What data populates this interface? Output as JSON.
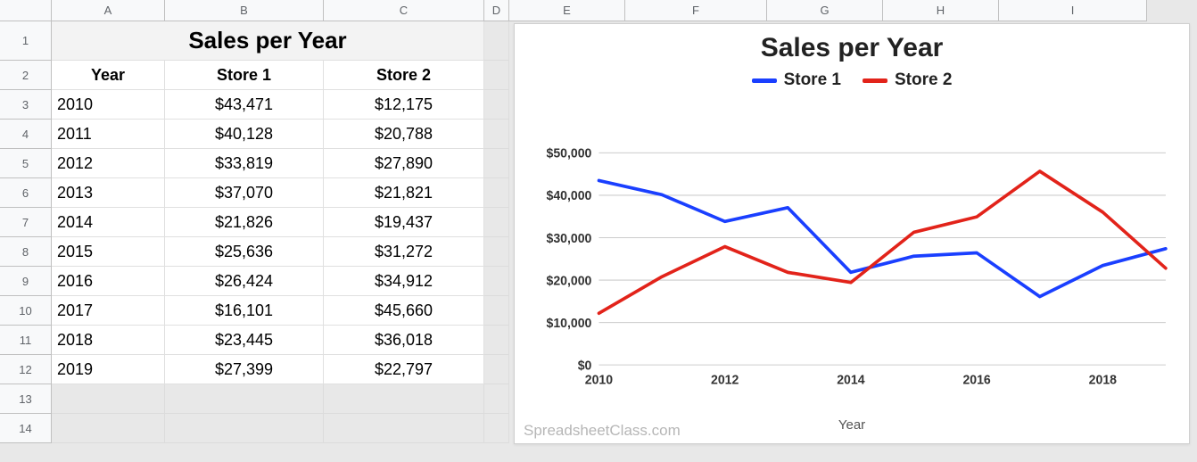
{
  "columns": {
    "labels": [
      "A",
      "B",
      "C",
      "D",
      "E",
      "F",
      "G",
      "H",
      "I"
    ],
    "widths": [
      127,
      178,
      180,
      28,
      130,
      159,
      130,
      130,
      166
    ]
  },
  "rows": {
    "labels": [
      "1",
      "2",
      "3",
      "4",
      "5",
      "6",
      "7",
      "8",
      "9",
      "10",
      "11",
      "12",
      "13",
      "14"
    ],
    "heights": [
      44,
      33,
      33,
      33,
      33,
      33,
      33,
      33,
      33,
      33,
      33,
      33,
      33,
      33
    ]
  },
  "table": {
    "title": "Sales per Year",
    "headers": {
      "year": "Year",
      "store1": "Store 1",
      "store2": "Store 2"
    },
    "data": [
      {
        "year": "2010",
        "store1": "$43,471",
        "store2": "$12,175"
      },
      {
        "year": "2011",
        "store1": "$40,128",
        "store2": "$20,788"
      },
      {
        "year": "2012",
        "store1": "$33,819",
        "store2": "$27,890"
      },
      {
        "year": "2013",
        "store1": "$37,070",
        "store2": "$21,821"
      },
      {
        "year": "2014",
        "store1": "$21,826",
        "store2": "$19,437"
      },
      {
        "year": "2015",
        "store1": "$25,636",
        "store2": "$31,272"
      },
      {
        "year": "2016",
        "store1": "$26,424",
        "store2": "$34,912"
      },
      {
        "year": "2017",
        "store1": "$16,101",
        "store2": "$45,660"
      },
      {
        "year": "2018",
        "store1": "$23,445",
        "store2": "$36,018"
      },
      {
        "year": "2019",
        "store1": "$27,399",
        "store2": "$22,797"
      }
    ]
  },
  "chart": {
    "title": "Sales per Year",
    "legend": [
      "Store 1",
      "Store 2"
    ],
    "xlabel": "Year",
    "watermark": "SpreadsheetClass.com",
    "colors": {
      "store1": "#1a3fff",
      "store2": "#e2231a"
    },
    "ylim": [
      0,
      50000
    ],
    "yticks": [
      0,
      10000,
      20000,
      30000,
      40000,
      50000
    ],
    "ytick_labels": [
      "$0",
      "$10,000",
      "$20,000",
      "$30,000",
      "$40,000",
      "$50,000"
    ],
    "xticks": [
      2010,
      2012,
      2014,
      2016,
      2018
    ],
    "xtick_labels": [
      "2010",
      "2012",
      "2014",
      "2016",
      "2018"
    ]
  },
  "chart_data": {
    "type": "line",
    "title": "Sales per Year",
    "xlabel": "Year",
    "ylabel": "",
    "ylim": [
      0,
      50000
    ],
    "categories": [
      2010,
      2011,
      2012,
      2013,
      2014,
      2015,
      2016,
      2017,
      2018,
      2019
    ],
    "series": [
      {
        "name": "Store 1",
        "color": "#1a3fff",
        "values": [
          43471,
          40128,
          33819,
          37070,
          21826,
          25636,
          26424,
          16101,
          23445,
          27399
        ]
      },
      {
        "name": "Store 2",
        "color": "#e2231a",
        "values": [
          12175,
          20788,
          27890,
          21821,
          19437,
          31272,
          34912,
          45660,
          36018,
          22797
        ]
      }
    ]
  }
}
